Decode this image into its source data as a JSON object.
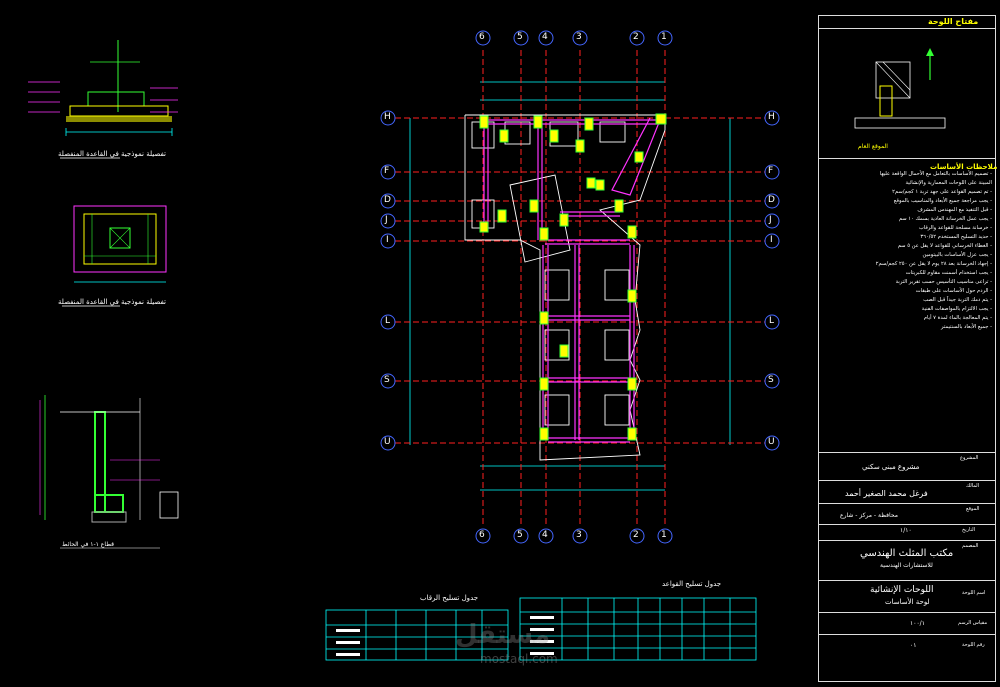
{
  "colors": {
    "background": "#000000",
    "grid": "#ff2020",
    "beam": "#ff33ff",
    "column": "#ffff00",
    "column_fill": "#33ff33",
    "dim": "#00ffff",
    "wall": "#ffffff",
    "bubble": "#4444ff"
  },
  "grid_axes": {
    "vertical": [
      "6",
      "5",
      "4",
      "3",
      "2",
      "1"
    ],
    "horizontal": [
      "H",
      "F",
      "D",
      "J",
      "I",
      "L",
      "S",
      "U"
    ]
  },
  "details": {
    "detail1_caption": "تفصيلة نموذجية في القاعدة المنفصلة",
    "detail2_caption": "تفصيلة نموذجية في القاعدة المنفصلة",
    "detail3_caption": "قطاع ١-١ في الحائط"
  },
  "tables": {
    "footing_title": "جدول تسليح القواعد",
    "neck_title": "جدول تسليح الرقاب"
  },
  "title_block": {
    "key_title": "مفتاح اللوحة",
    "key_caption": "الموقع العام",
    "notes_title": "ملاحظات الأساسات",
    "notes": [
      "- تصميم الأساسات بالتعامل مع الأحمال الواقعة عليها",
      "  المبينة على اللوحات المعمارية والإنشائية",
      "- تم تصميم القواعد على جهد تربة ١ كجم/سم٢",
      "- يجب مراجعة جميع الأبعاد والمناسيب بالموقع",
      "- قبل التنفيذ مع المهندس المشرف",
      "- يجب عمل الخرسانة العادية بسمك ١٠ سم",
      "- خرسانة مسلحة للقواعد والرقاب",
      "- حديد التسليح المستخدم ٣٦٠/٥٢",
      "- الغطاء الخرساني للقواعد لا يقل عن ٥ سم",
      "- يجب عزل الأساسات بالبيتومين",
      "- إجهاد الخرسانة بعد ٢٨ يوم لا يقل عن ٢٥٠ كجم/سم٢",
      "- يجب استخدام أسمنت مقاوم للكبريتات",
      "- تراعى مناسيب التأسيس حسب تقرير التربة",
      "- الردم حول الأساسات على طبقات",
      "- يتم دمك التربة جيداً قبل الصب",
      "- يجب الالتزام بالمواصفات الفنية",
      "- يتم المعالجة بالماء لمدة ٧ أيام",
      "- جميع الأبعاد بالسنتيمتر"
    ],
    "project_label": "المشروع",
    "project_value": "مشروع مبنى سكني",
    "owner_label": "المالك",
    "owner_value": "فرغل محمد الصغير أحمد",
    "location_label": "الموقع",
    "location_value": "محافظة - مركز - شارع",
    "scale_label": "مقياس الرسم",
    "scale_value": "١٠٠/١",
    "office_label": "المصمم",
    "office_value": "مكتب المثلث الهندسي",
    "office_sub": "للاستشارات الهندسية",
    "drawing_label": "اسم اللوحة",
    "drawing_value": "اللوحات الإنشائية",
    "drawing_sub": "لوحة الأساسات",
    "sheet_label": "رقم اللوحة",
    "sheet_value": "٠١",
    "date_label": "التاريخ",
    "date_value": "١/١٠"
  },
  "watermark": {
    "text": "مستقل",
    "url": "mostaql.com"
  }
}
